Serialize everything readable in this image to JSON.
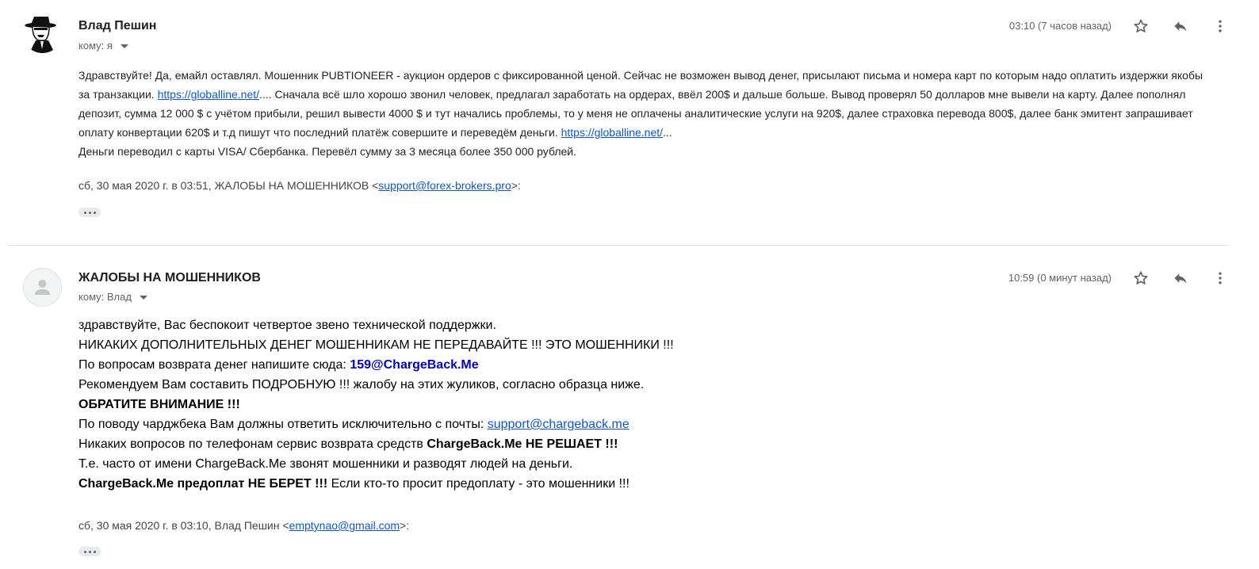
{
  "messages": [
    {
      "sender": "Влад Пешин",
      "to_label": "кому: я",
      "time": "03:10 (7 часов назад)",
      "avatar": "man-in-hat-avatar",
      "body": {
        "p1": "Здравствуйте! Да, емайл оставлял. Мошенник PUBTIONEER - аукцион ордеров с фиксированной ценой. Сейчас не возможен вывод денег, присылают письма и номера карт по которым надо оплатить издержки якобы за транзакции.",
        "link1": "https://globalline.net/",
        "p2": ".... Сначала всё шло хорошо звонил человек, предлагал заработать на ордерах, ввёл 200$ и дальше больше. Вывод проверял 50 долларов мне вывели на карту. Далее пополнял депозит, сумма 12 000 $ с учётом прибыли, решил вывести 4000 $ и тут начались проблемы, то у меня не оплачены аналитические услуги на 920$, далее страховка перевода 800$, далее банк эмитент запрашивает оплату конвертации 620$ и т.д пишут что последний платёж совершите и переведём деньги.",
        "link2": "https://globalline.net/",
        "p3": "...",
        "p4": "Деньги переводил с карты VISA/ Сбербанка. Перевёл сумму за 3 месяца более 350 000 рублей."
      },
      "quote_prefix": "сб, 30 мая 2020 г. в 03:51, ЖАЛОБЫ НА МОШЕННИКОВ <",
      "quote_email": "support@forex-brokers.pro",
      "quote_suffix": ">:"
    },
    {
      "sender": "ЖАЛОБЫ НА МОШЕННИКОВ",
      "to_label": "кому: Влад",
      "time": "10:59 (0 минут назад)",
      "avatar": "default-person-avatar",
      "body": {
        "l1": "здравствуйте, Вас беспокоит четвертое звено технической поддержки.",
        "l2": "НИКАКИХ ДОПОЛНИТЕЛЬНЫХ ДЕНЕГ МОШЕННИКАМ НЕ ПЕРЕДАВАЙТЕ !!! ЭТО МОШЕННИКИ !!!",
        "l3_text": "По вопросам возврата денег напишите сюда: ",
        "l3_email": "159@ChargeBack.Me",
        "l4": "Рекомендуем Вам составить ПОДРОБНУЮ !!! жалобу на этих жуликов, согласно образца ниже.",
        "l5": "ОБРАТИТЕ ВНИМАНИЕ !!!",
        "l6_text": "По поводу чарджбека Вам должны ответить исключительно с почты: ",
        "l6_email": "support@chargeback.me",
        "l7_text": "Никаких вопросов по телефонам сервис возврата средств ",
        "l7_bold": "ChargeBack.Me НЕ РЕШАЕТ !!!",
        "l8": "Т.е. часто от имени ChargeBack.Me звонят мошенники и разводят людей на деньги.",
        "l9_bold": "ChargeBack.Me предоплат НЕ БЕРЕТ !!!",
        "l9_text": " Если кто-то просит предоплату - это мошенники !!!"
      },
      "quote_prefix": "сб, 30 мая 2020 г. в 03:10, Влад Пешин <",
      "quote_email": "emptynao@gmail.com",
      "quote_suffix": ">:"
    }
  ],
  "icons": {
    "star": "star-icon",
    "reply": "reply-icon",
    "more": "more-vert-icon",
    "expand": "ellipsis-icon"
  },
  "colors": {
    "link": "#1155cc",
    "secondary_text": "#5f6368",
    "blue_bold": "#0000cc"
  }
}
